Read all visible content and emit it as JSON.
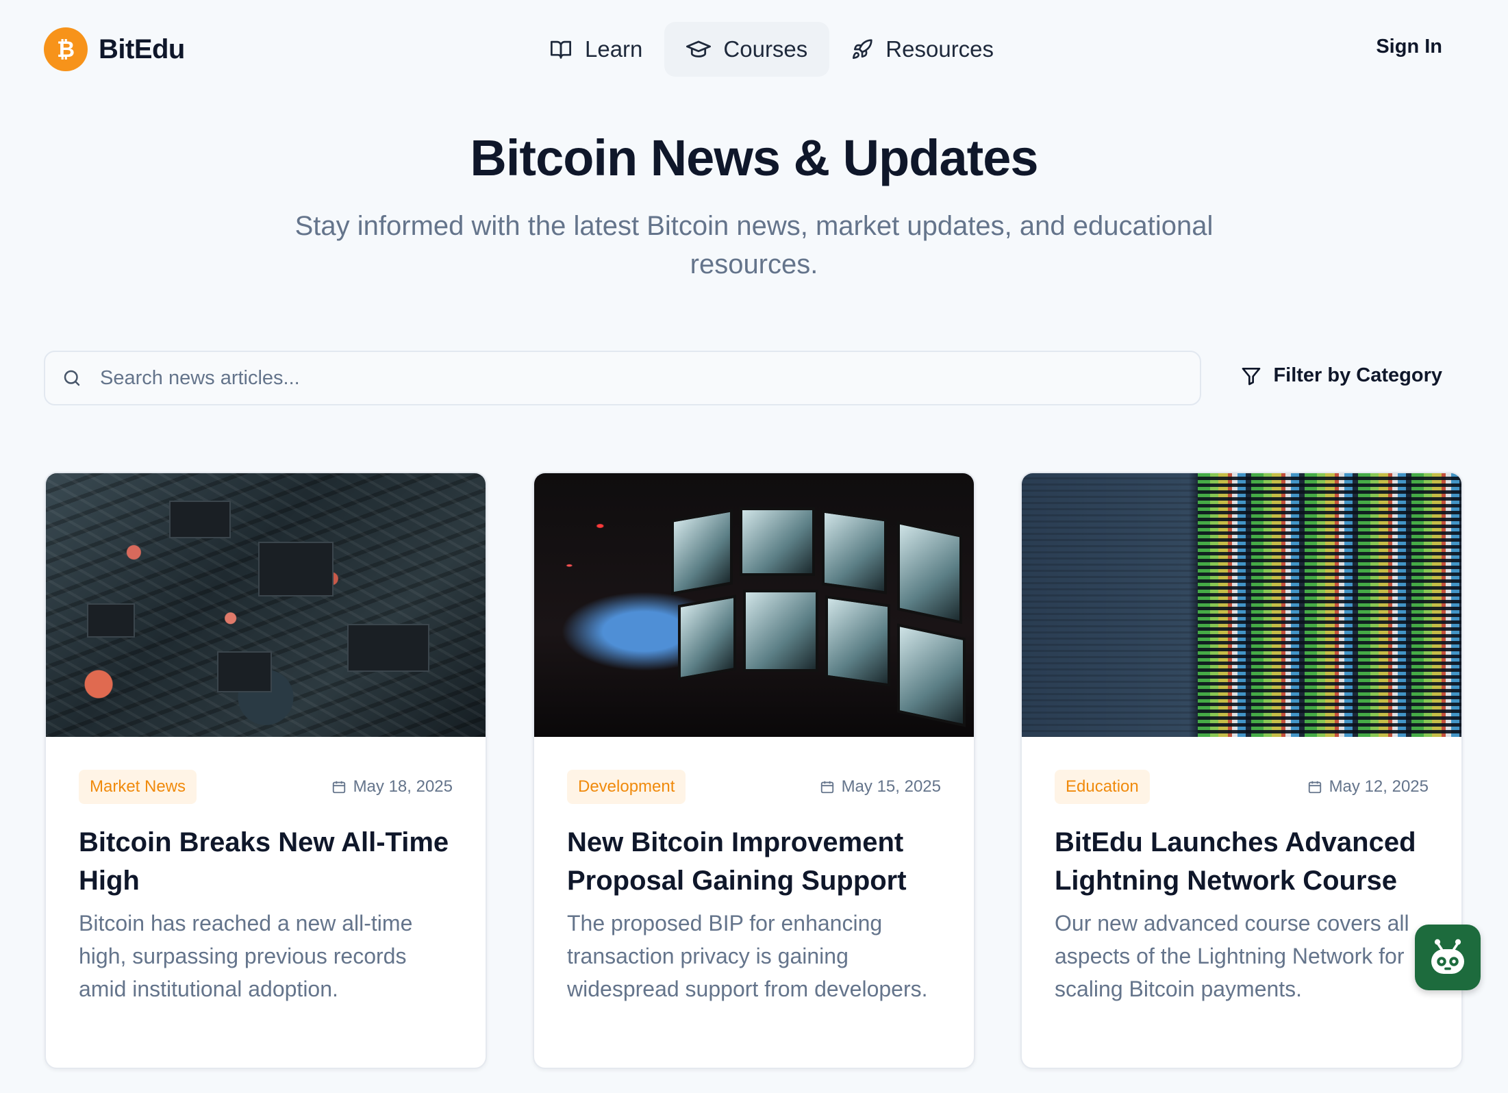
{
  "brand": {
    "name": "BitEdu",
    "logo_glyph": "₿",
    "color": "#f7931a"
  },
  "nav": {
    "items": [
      {
        "label": "Learn",
        "icon": "book-open-icon",
        "active": false
      },
      {
        "label": "Courses",
        "icon": "graduation-cap-icon",
        "active": true
      },
      {
        "label": "Resources",
        "icon": "rocket-icon",
        "active": false
      }
    ],
    "sign_in": "Sign In"
  },
  "hero": {
    "title": "Bitcoin News & Updates",
    "subtitle": "Stay informed with the latest Bitcoin news, market updates, and educational resources."
  },
  "search": {
    "placeholder": "Search news articles...",
    "value": ""
  },
  "filter": {
    "label": "Filter by Category",
    "icon": "filter-icon"
  },
  "articles": [
    {
      "category": "Market News",
      "date": "May 18, 2025",
      "title": "Bitcoin Breaks New All-Time High",
      "summary": "Bitcoin has reached a new all-time high, surpassing previous records amid institutional adoption.",
      "image": "circuit-board-photo"
    },
    {
      "category": "Development",
      "date": "May 15, 2025",
      "title": "New Bitcoin Improvement Proposal Gaining Support",
      "summary": "The proposed BIP for enhancing transaction privacy is gaining widespread support from developers.",
      "image": "video-screens-photo"
    },
    {
      "category": "Education",
      "date": "May 12, 2025",
      "title": "BitEdu Launches Advanced Lightning Network Course",
      "summary": "Our new advanced course covers all aspects of the Lightning Network for scaling Bitcoin payments.",
      "image": "code-screen-photo"
    }
  ],
  "colors": {
    "accent": "#f7931a",
    "tag_bg": "#fff4e6",
    "tag_text": "#f08a0c",
    "helper_bg": "#1d6b3d"
  }
}
